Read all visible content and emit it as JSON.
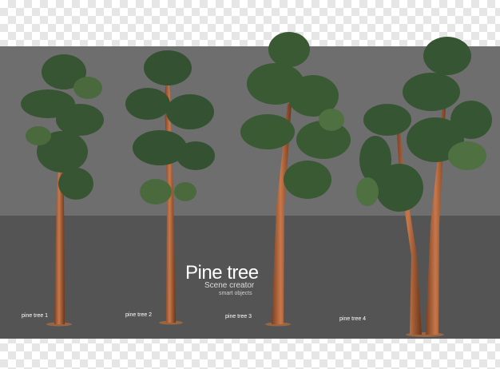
{
  "title": "Pine tree",
  "subtitle": "Scene creator",
  "tagline": "smart objects",
  "trees": [
    {
      "label": "pine tree 1"
    },
    {
      "label": "pine tree 2"
    },
    {
      "label": "pine tree 3"
    },
    {
      "label": "pine tree 4"
    }
  ],
  "colors": {
    "wall": "#6e6e6e",
    "floor": "#545454",
    "foliage_dark": "#2e4a2a",
    "foliage_light": "#4f7040",
    "trunk": "#b0643a",
    "checker": "#e6e6e6"
  }
}
